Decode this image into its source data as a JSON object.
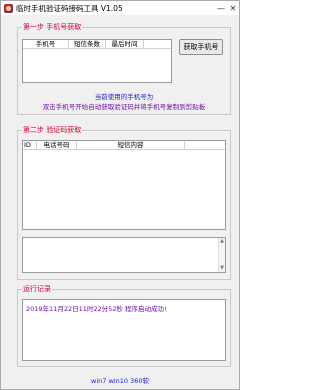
{
  "window": {
    "title": "临时手机验证码接码工具 V1.05",
    "minimize": "—",
    "close": "✕"
  },
  "step1": {
    "legend": "第一步  手机号获取",
    "columns": [
      "手机号",
      "短信条数",
      "最后时间"
    ],
    "get_button": "获取手机号",
    "current_phone_label": "当前使用的手机号为",
    "instruction": "双击手机号开始自动获取验证码并将手机号复制到剪贴板"
  },
  "step2": {
    "legend": "第二步  验证码获取",
    "columns": [
      "ID",
      "电话号码",
      "短信内容"
    ]
  },
  "log": {
    "legend": "运行记录",
    "entry": "2019年11月22日11时22分52秒   程序启动成功!"
  },
  "footer": {
    "text": "win7 win10 360软"
  }
}
